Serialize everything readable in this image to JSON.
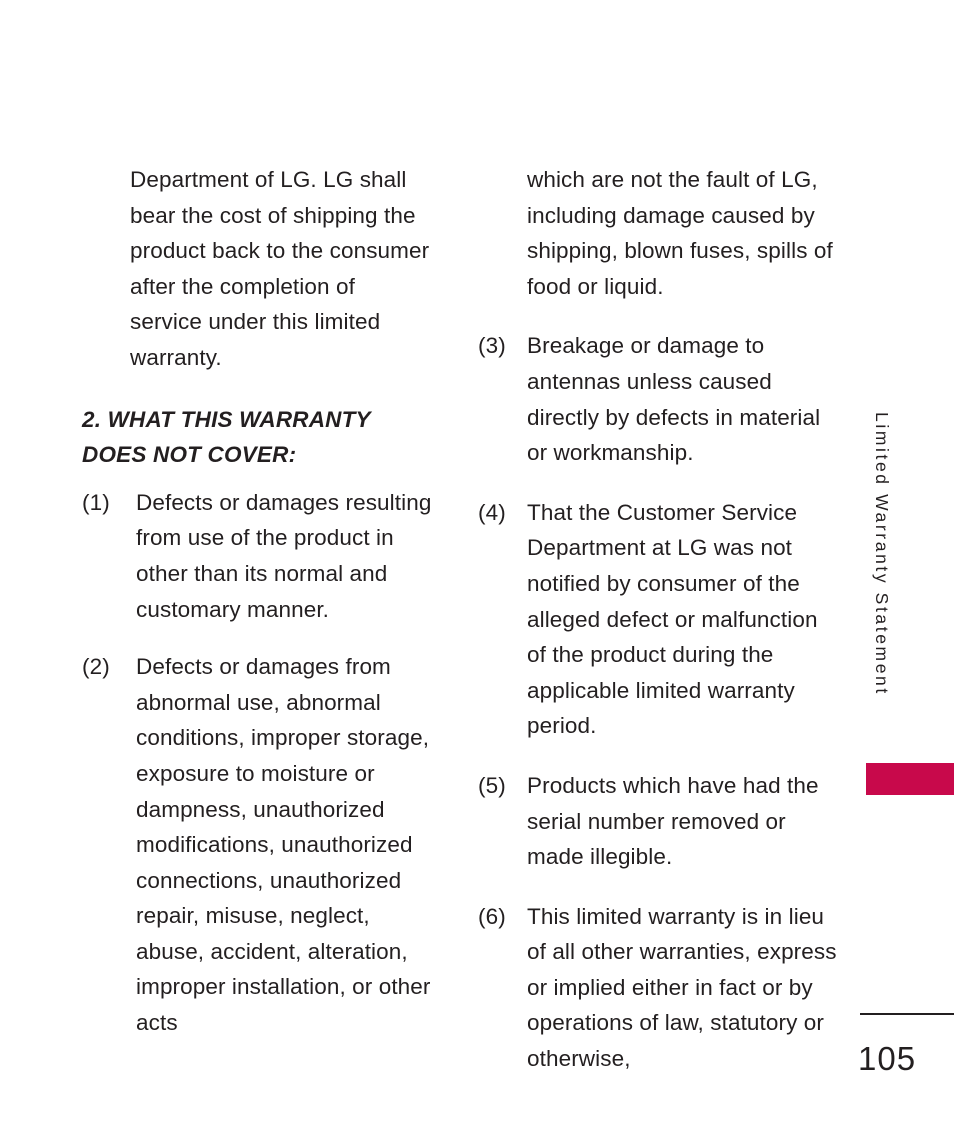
{
  "document": {
    "page_number": "105",
    "side_tab": {
      "label": "Limited Warranty Statement",
      "swatch_color": "#c8094b"
    },
    "text_color": "#231f20"
  },
  "left_column": {
    "continued_paragraph": "Department of LG. LG shall bear the cost of shipping the product back to the consumer after the completion of service under this limited warranty.",
    "heading": "2. WHAT THIS WARRANTY DOES NOT COVER:",
    "items": [
      {
        "marker": "(1)",
        "text": "Defects or damages resulting from use of the product in other than its normal and customary manner."
      },
      {
        "marker": "(2)",
        "text": "Defects or damages from abnormal use, abnormal conditions, improper storage, exposure to moisture or dampness, unauthorized modifications, unauthorized connections, unauthorized repair, misuse, neglect, abuse, accident, alteration, improper installation, or other acts"
      }
    ]
  },
  "right_column": {
    "continued_paragraph": "which are not the fault of LG, including damage caused by shipping, blown fuses, spills of food or liquid.",
    "items": [
      {
        "marker": "(3)",
        "text": "Breakage or damage to antennas unless caused directly by defects in material or workmanship."
      },
      {
        "marker": "(4)",
        "text": "That the Customer Service Department at LG was not notified by consumer of the alleged defect or malfunction of the product during the applicable limited warranty period."
      },
      {
        "marker": "(5)",
        "text": "Products which have had the serial number removed or made illegible."
      },
      {
        "marker": "(6)",
        "text": "This limited warranty is in lieu of all other warranties, express or implied either in fact or by operations of law, statutory or otherwise,"
      }
    ]
  }
}
